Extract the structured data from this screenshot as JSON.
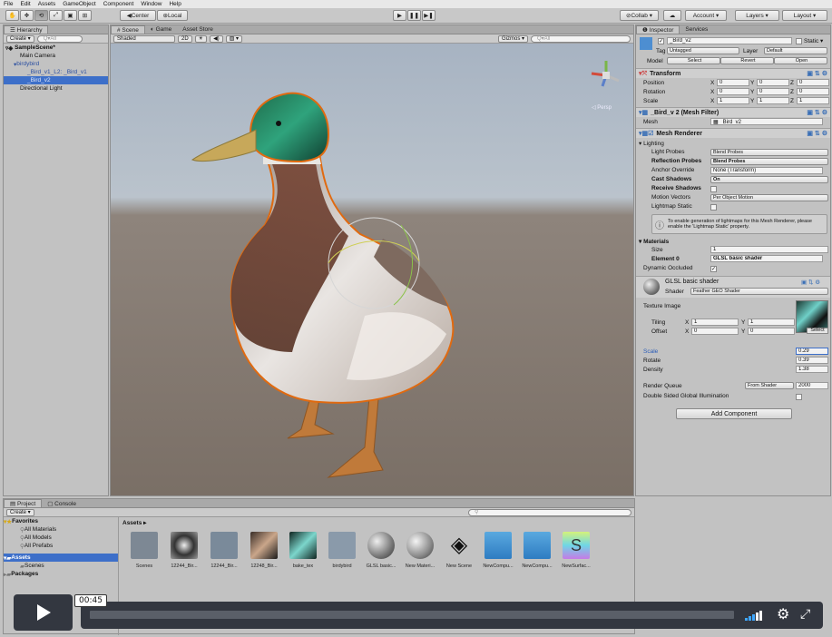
{
  "menu": [
    "File",
    "Edit",
    "Assets",
    "GameObject",
    "Component",
    "Window",
    "Help"
  ],
  "toolbar": {
    "tools": [
      "hand-icon",
      "move-icon",
      "rotate-icon",
      "scale-icon",
      "rect-icon",
      "transform-icon"
    ],
    "pivot": "◀Center",
    "space": "⊛Local",
    "collab": "⊘Collab ▾",
    "account": "Account ▾",
    "layers": "Layers ▾",
    "layout": "Layout ▾"
  },
  "hierarchy": {
    "tab": "☰ Hierarchy",
    "create": "Create ▾",
    "search": "Q▾All",
    "scene": "SampleScene*",
    "items": [
      "Main Camera",
      "birdybird",
      "_Bird_v1_L2: _Bird_v1",
      "_Bird_v2",
      "Directional Light"
    ]
  },
  "scene": {
    "tabs": [
      "# Scene",
      "◐ Game",
      "Asset Store"
    ],
    "shading": "Shaded",
    "mode2d": "2D",
    "gizmos": "Gizmos ▾",
    "search": "Q▾All",
    "persp": "◁ Persp"
  },
  "inspector": {
    "tabs": [
      "❶ Inspector",
      "Services"
    ],
    "object_name": "_Bird_v2",
    "static": "Static ▾",
    "tag_label": "Tag",
    "tag_value": "Untagged",
    "layer_label": "Layer",
    "layer_value": "Default",
    "model_label": "Model",
    "model_buttons": [
      "Select",
      "Revert",
      "Open"
    ],
    "transform": {
      "title": "Transform",
      "rows": [
        {
          "label": "Position",
          "x": "0",
          "y": "0",
          "z": "0"
        },
        {
          "label": "Rotation",
          "x": "0",
          "y": "0",
          "z": "0"
        },
        {
          "label": "Scale",
          "x": "1",
          "y": "1",
          "z": "1"
        }
      ]
    },
    "mesh_filter": {
      "title": "_Bird_v 2 (Mesh Filter)",
      "mesh_label": "Mesh",
      "mesh_value": "▦ _Bird_v2"
    },
    "mesh_renderer": {
      "title": "Mesh Renderer",
      "lighting": "Lighting",
      "rows": [
        {
          "label": "Light Probes",
          "value": "Blend Probes"
        },
        {
          "label": "Reflection Probes",
          "value": "Blend Probes"
        },
        {
          "label": "Anchor Override",
          "value": "None (Transform)"
        },
        {
          "label": "Cast Shadows",
          "value": "On"
        },
        {
          "label": "Receive Shadows",
          "value": ""
        },
        {
          "label": "Motion Vectors",
          "value": "Per Object Motion"
        },
        {
          "label": "Lightmap Static",
          "value": ""
        }
      ],
      "info": "To enable generation of lightmaps for this Mesh Renderer, please enable the 'Lightmap Static' property.",
      "materials": "Materials",
      "size_label": "Size",
      "size_value": "1",
      "element_label": "Element 0",
      "element_value": "GLSL basic shader",
      "dynamic_occluded": "Dynamic Occluded"
    },
    "material": {
      "name": "GLSL basic shader",
      "shader_label": "Shader",
      "shader_value": "Feather GEO Shader",
      "texture_label": "Texture Image",
      "tiling_label": "Tiling",
      "tiling_x": "1",
      "tiling_y": "1",
      "offset_label": "Offset",
      "offset_x": "0",
      "offset_y": "0",
      "select": "Select",
      "props": [
        {
          "label": "Scale",
          "value": "0.29"
        },
        {
          "label": "Rotate",
          "value": "0.39"
        },
        {
          "label": "Density",
          "value": "1.38"
        }
      ],
      "render_queue_label": "Render Queue",
      "render_queue_mode": "From Shader",
      "render_queue_value": "2000",
      "double_sided": "Double Sided Global Illumination"
    },
    "add_component": "Add Component"
  },
  "project": {
    "tabs": [
      "▤ Project",
      "▢ Console"
    ],
    "create": "Create ▾",
    "favorites": "Favorites",
    "fav_items": [
      "All Materials",
      "All Models",
      "All Prefabs"
    ],
    "assets_root": "Assets",
    "asset_children": [
      "Scenes"
    ],
    "packages": "Packages",
    "breadcrumb": "Assets ▸",
    "items": [
      "Scenes",
      "12244_Bir...",
      "12244_Bir...",
      "12248_Bir...",
      "bake_tex",
      "birdybird",
      "GLSL basic...",
      "New Materi...",
      "New Scene",
      "NewCompu...",
      "NewCompu...",
      "NewSurfac..."
    ]
  },
  "video": {
    "time": "00:45",
    "progress": 0.0
  },
  "colors": {
    "accent_selection": "#3d6fc9",
    "scene_ground": "#7a6f66",
    "scene_sky": "#aab6c4",
    "overlay_bar": "#333740"
  }
}
